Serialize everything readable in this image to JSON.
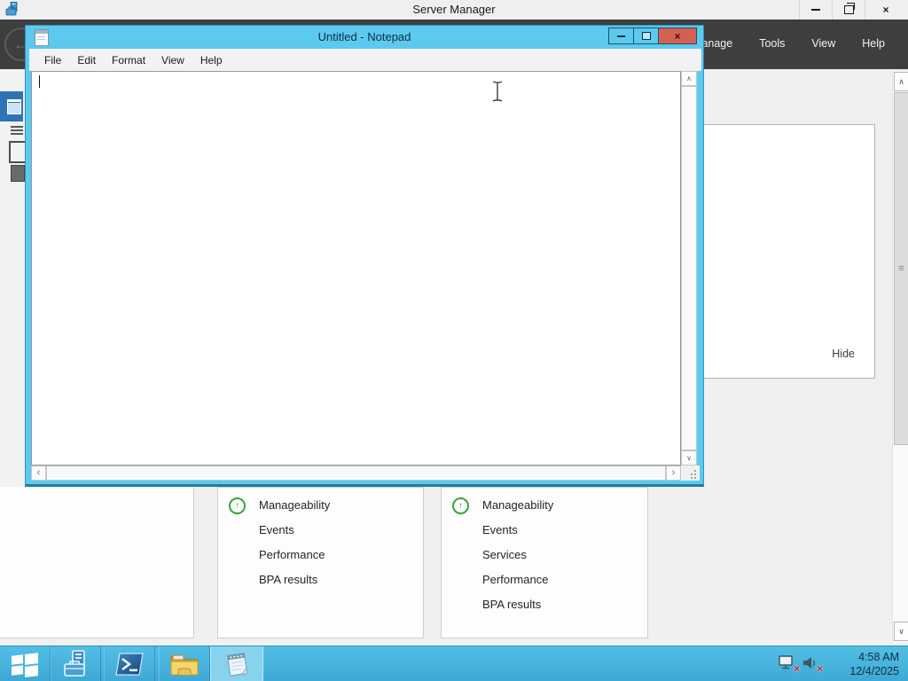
{
  "server_manager": {
    "title": "Server Manager",
    "menu_items": [
      "Manage",
      "Tools",
      "View",
      "Help"
    ],
    "welcome_panel": {
      "hide_label": "Hide"
    },
    "dashboard_tiles": [
      {
        "rows": [
          "Manageability",
          "Events",
          "Performance",
          "BPA results"
        ]
      },
      {
        "rows": [
          "Manageability",
          "Events",
          "Services",
          "Performance",
          "BPA results"
        ]
      }
    ]
  },
  "notepad": {
    "title": "Untitled - Notepad",
    "menu_items": [
      "File",
      "Edit",
      "Format",
      "View",
      "Help"
    ],
    "text_value": ""
  },
  "taskbar": {
    "clock": {
      "time": "4:58 AM",
      "date": "12/4/2025"
    }
  },
  "glyphs": {
    "close": "×",
    "back_arrow": "←",
    "chevron_up": "∧",
    "chevron_down": "∨",
    "chevron_left": "‹",
    "chevron_right": "›",
    "thumb_grip": "≡",
    "status_up_arrow": "↑"
  },
  "colors": {
    "notepad_frame_cyan": "#5cc9ee",
    "taskbar_blue": "#47b7e2",
    "close_button_red": "#d6604f",
    "status_green": "#35a539",
    "nav_selected_blue": "#2d74b5",
    "dark_menu_band": "#3e3e3e"
  }
}
